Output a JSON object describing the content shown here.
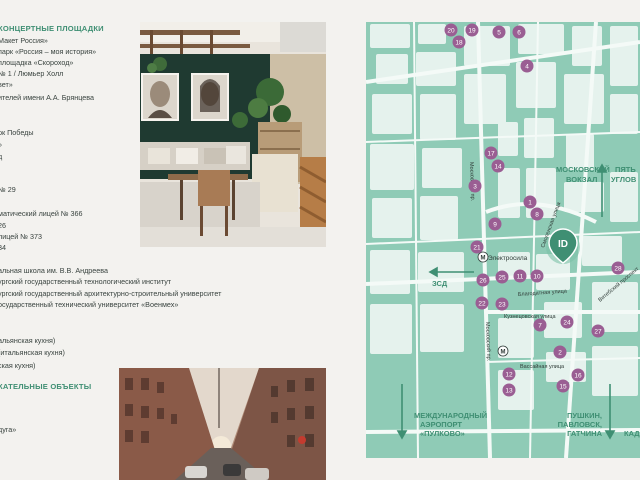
{
  "left_list": {
    "heading_venues": "КОНЦЕРТНЫЕ ПЛОЩАДКИ",
    "venues": [
      "Макет Россия»",
      "парк «Россия – моя история»",
      "площадка «Скороход»",
      "№ 1 / Люмьер Холл",
      "вет»",
      "ителей имени А.А. Брянцева"
    ],
    "park": "рк Победы",
    "park_sub1": "»",
    "park_sub2": "д",
    "schools": [
      "№ 29",
      "",
      "матический лицей № 366",
      "26",
      "лицей № 373",
      "34"
    ],
    "universities": [
      "альная школа им. В.В. Андреева",
      "ургский государственный технологический институт",
      "ургский государственный архитектурно-строительный университет",
      "осударственный технический университет «Военмех»"
    ],
    "restaurants": [
      "альянская кухня)",
      "(итальянская кухня)",
      "ская кухня)"
    ],
    "heading_sights": "КАТЕЛЬНЫЕ ОБЪЕКТЫ",
    "sights_last": "дуга»"
  },
  "map": {
    "streets": {
      "electrosila": "Электросила",
      "moskovsky_prospect": "Московский пр.",
      "smolenskaya": "Смоленская улица",
      "blagodatnaya": "Благодатная улица",
      "kuznetsovskaya": "Кузнецовская улица",
      "vassayna": "Вассайная улица",
      "vitebsky": "Витебский проспект"
    },
    "directions": {
      "moskovsky_vokzal_1": "МОСКОВСКИЙ",
      "moskovsky_vokzal_2": "ВОКЗАЛ",
      "pyat_uglov_1": "ПЯТЬ",
      "pyat_uglov_2": "УГЛОВ",
      "zsd": "ЗСД",
      "airport_1": "МЕЖДУНАРОДНЫЙ",
      "airport_2": "АЭРОПОРТ",
      "airport_3": "«ПУЛКОВО»",
      "pushkin_1": "ПУШКИН,",
      "pushkin_2": "ПАВЛОВСК,",
      "pushkin_3": "ГАТЧИНА",
      "kad": "КАД"
    },
    "metro_symbol": "M",
    "project_logo": "ID",
    "markers": [
      "20",
      "19",
      "5",
      "6",
      "18",
      "4",
      "17",
      "14",
      "3",
      "1",
      "8",
      "9",
      "21",
      "26",
      "25",
      "11",
      "10",
      "28",
      "22",
      "23",
      "7",
      "24",
      "27",
      "2",
      "12",
      "15",
      "16",
      "13"
    ]
  },
  "colors": {
    "map_bg": "#8fcbb6",
    "block": "#e5f2ed",
    "marker": "#9a5e93",
    "accent": "#3f8f73",
    "page_bg": "#f3f2ef"
  }
}
